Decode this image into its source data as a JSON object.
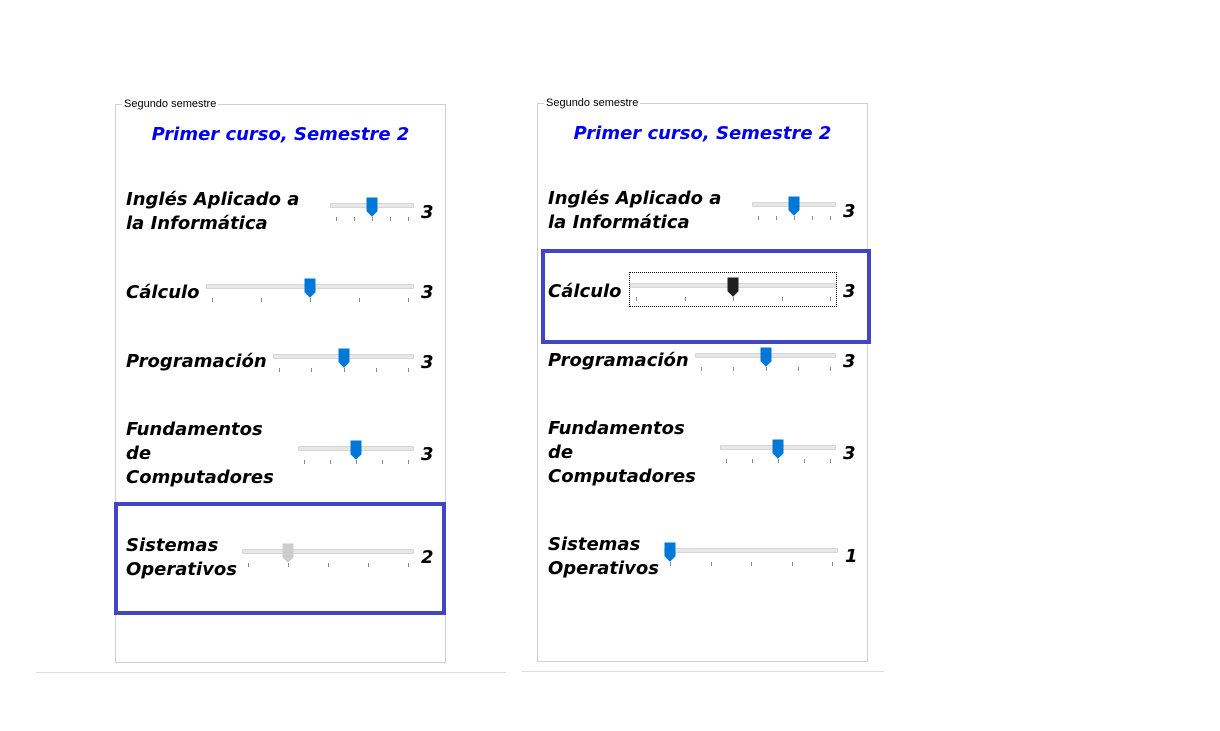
{
  "panels": [
    {
      "group_title": "Segundo semestre",
      "course_title": "Primer curso, Semestre 2",
      "subjects": [
        {
          "label": "Inglés Aplicado a\nla Informática",
          "value": "3",
          "slider_fraction": 0.5,
          "state": "normal"
        },
        {
          "label": "Cálculo",
          "value": "3",
          "slider_fraction": 0.5,
          "state": "normal"
        },
        {
          "label": "Programación",
          "value": "3",
          "slider_fraction": 0.5,
          "state": "normal"
        },
        {
          "label": "Fundamentos\nde\nComputadores",
          "value": "3",
          "slider_fraction": 0.5,
          "state": "normal"
        },
        {
          "label": "Sistemas\nOperativos",
          "value": "2",
          "slider_fraction": 0.25,
          "state": "disabled"
        }
      ]
    },
    {
      "group_title": "Segundo semestre",
      "course_title": "Primer curso, Semestre 2",
      "subjects": [
        {
          "label": "Inglés Aplicado a\nla Informática",
          "value": "3",
          "slider_fraction": 0.5,
          "state": "normal"
        },
        {
          "label": "Cálculo",
          "value": "3",
          "slider_fraction": 0.5,
          "state": "focused"
        },
        {
          "label": "Programación",
          "value": "3",
          "slider_fraction": 0.5,
          "state": "normal"
        },
        {
          "label": "Fundamentos\nde\nComputadores",
          "value": "3",
          "slider_fraction": 0.5,
          "state": "normal"
        },
        {
          "label": "Sistemas\nOperativos",
          "value": "1",
          "slider_fraction": 0.0,
          "state": "normal"
        }
      ]
    }
  ],
  "colors": {
    "accent": "#0078d7",
    "disabled_thumb": "#cccccc",
    "focused_thumb": "#1f1f1f",
    "title": "#0000ee",
    "highlight": "#4046c4"
  }
}
